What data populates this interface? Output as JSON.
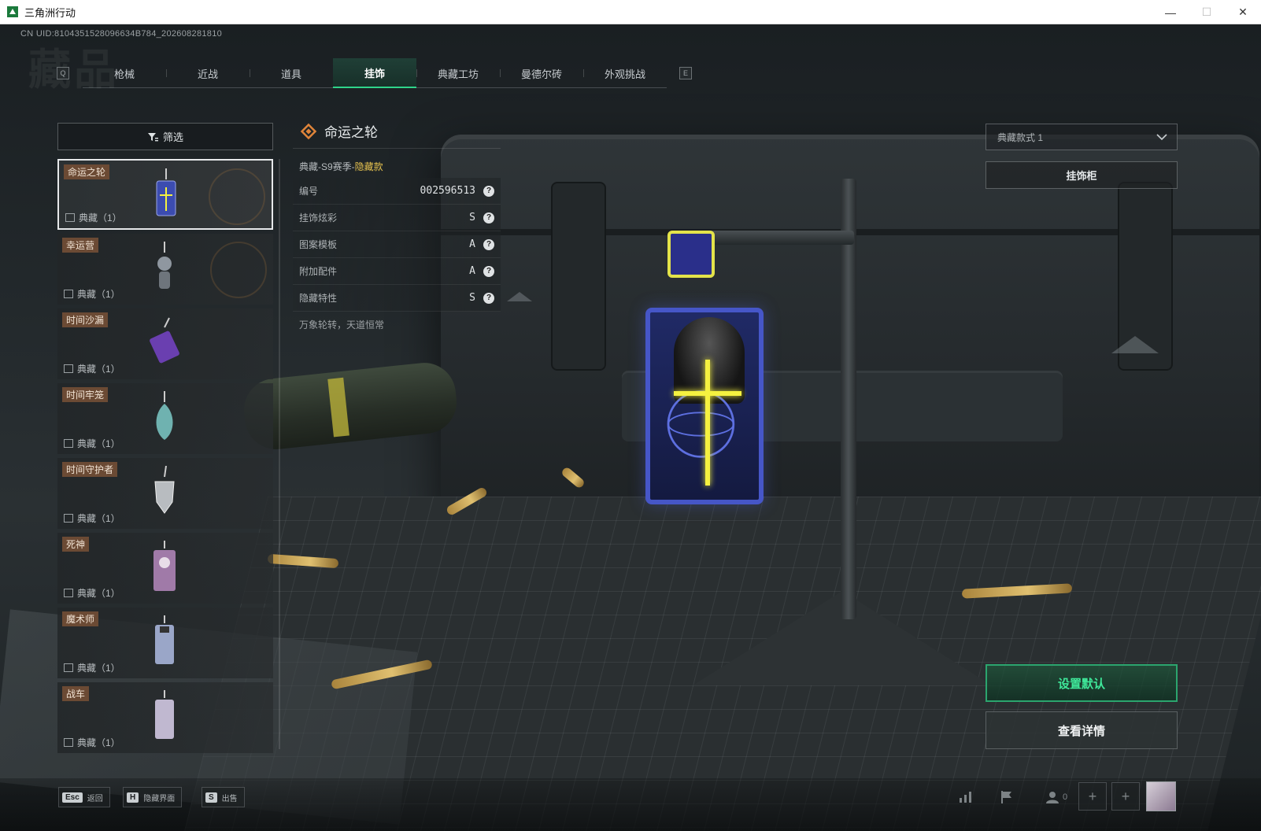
{
  "window": {
    "title": "三角洲行动",
    "controls": {
      "minimize": "—",
      "maximize": "☐",
      "close": "✕"
    }
  },
  "uid": "CN UID:8104351528096634B784_202608281810",
  "watermark": "藏品",
  "tabs": {
    "prev_key": "Q",
    "next_key": "E",
    "items": [
      {
        "label": "枪械",
        "active": false
      },
      {
        "label": "近战",
        "active": false
      },
      {
        "label": "道具",
        "active": false
      },
      {
        "label": "挂饰",
        "active": true
      },
      {
        "label": "典藏工坊",
        "active": false
      },
      {
        "label": "曼德尔砖",
        "active": false
      },
      {
        "label": "外观挑战",
        "active": false
      }
    ]
  },
  "filter": {
    "label": "筛选",
    "icon": "filter-icon"
  },
  "list": {
    "items": [
      {
        "name": "命运之轮",
        "count": "典藏（1）",
        "selected": true,
        "thumb_color": "#3c4cb0"
      },
      {
        "name": "幸运营",
        "count": "典藏（1）",
        "selected": false,
        "thumb_color": "#8f97a0"
      },
      {
        "name": "时间沙漏",
        "count": "典藏（1）",
        "selected": false,
        "thumb_color": "#6a3fb0"
      },
      {
        "name": "时间牢笼",
        "count": "典藏（1）",
        "selected": false,
        "thumb_color": "#6fb2b0"
      },
      {
        "name": "时间守护者",
        "count": "典藏（1）",
        "selected": false,
        "thumb_color": "#b8bcc0"
      },
      {
        "name": "死神",
        "count": "典藏（1）",
        "selected": false,
        "thumb_color": "#a07aa8"
      },
      {
        "name": "魔术师",
        "count": "典藏（1）",
        "selected": false,
        "thumb_color": "#9aa6c8"
      },
      {
        "name": "战车",
        "count": "典藏（1）",
        "selected": false,
        "thumb_color": "#c0b8d0"
      }
    ]
  },
  "detail": {
    "title": "命运之轮",
    "subtitle_prefix": "典藏-S9赛季-",
    "subtitle_rarity": "隐藏款",
    "attributes": [
      {
        "label": "编号",
        "value": "002596513"
      },
      {
        "label": "挂饰炫彩",
        "value": "S"
      },
      {
        "label": "图案模板",
        "value": "A"
      },
      {
        "label": "附加配件",
        "value": "A"
      },
      {
        "label": "隐藏特性",
        "value": "S"
      }
    ],
    "help_glyph": "?",
    "flavor": "万象轮转，天道恒常"
  },
  "right": {
    "style_select": "典藏款式 1",
    "cabinet_label": "挂饰柜",
    "set_default_label": "设置默认",
    "view_details_label": "查看详情"
  },
  "bottom": {
    "hints": [
      {
        "key": "Esc",
        "label": "返回"
      },
      {
        "key": "H",
        "label": "隐藏界面"
      },
      {
        "key": "S",
        "label": "出售"
      }
    ],
    "friends_count": "0",
    "plus_glyph": "+"
  },
  "colors": {
    "accent_green": "#2fd48a",
    "rare_gold": "#e6c24f",
    "charm_blue": "#4656c8",
    "charm_yellow": "#f5f140"
  }
}
